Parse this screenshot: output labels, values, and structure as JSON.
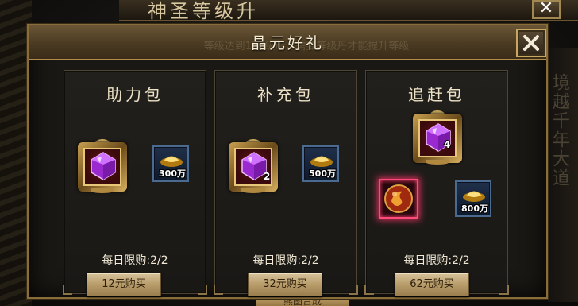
{
  "background": {
    "window_title": "神圣等级升",
    "header_ghost_text": "等级达到120级后，需要等级丹才能提升等级",
    "right_vertical_text": "境越千年大道",
    "bottom_button": "熊图合成"
  },
  "dialog": {
    "title": "晶元好礼",
    "close_icon": "close-x-icon"
  },
  "packs": [
    {
      "title": "助力包",
      "gem_qty": "",
      "gold_amount": "300万",
      "limit": "每日限购:2/2",
      "price": "12元购买"
    },
    {
      "title": "补充包",
      "gem_qty": "2",
      "gold_amount": "500万",
      "limit": "每日限购:2/2",
      "price": "32元购买"
    },
    {
      "title": "追赶包",
      "gem_qty": "4",
      "gold_amount": "800万",
      "limit": "每日限购:2/2",
      "price": "62元购买"
    }
  ],
  "colors": {
    "accent_gold": "#c8a050",
    "gem_purple": "#b040e0",
    "orb_highlight": "#ff4a7a",
    "gold_slot_border": "#4a6a90"
  }
}
